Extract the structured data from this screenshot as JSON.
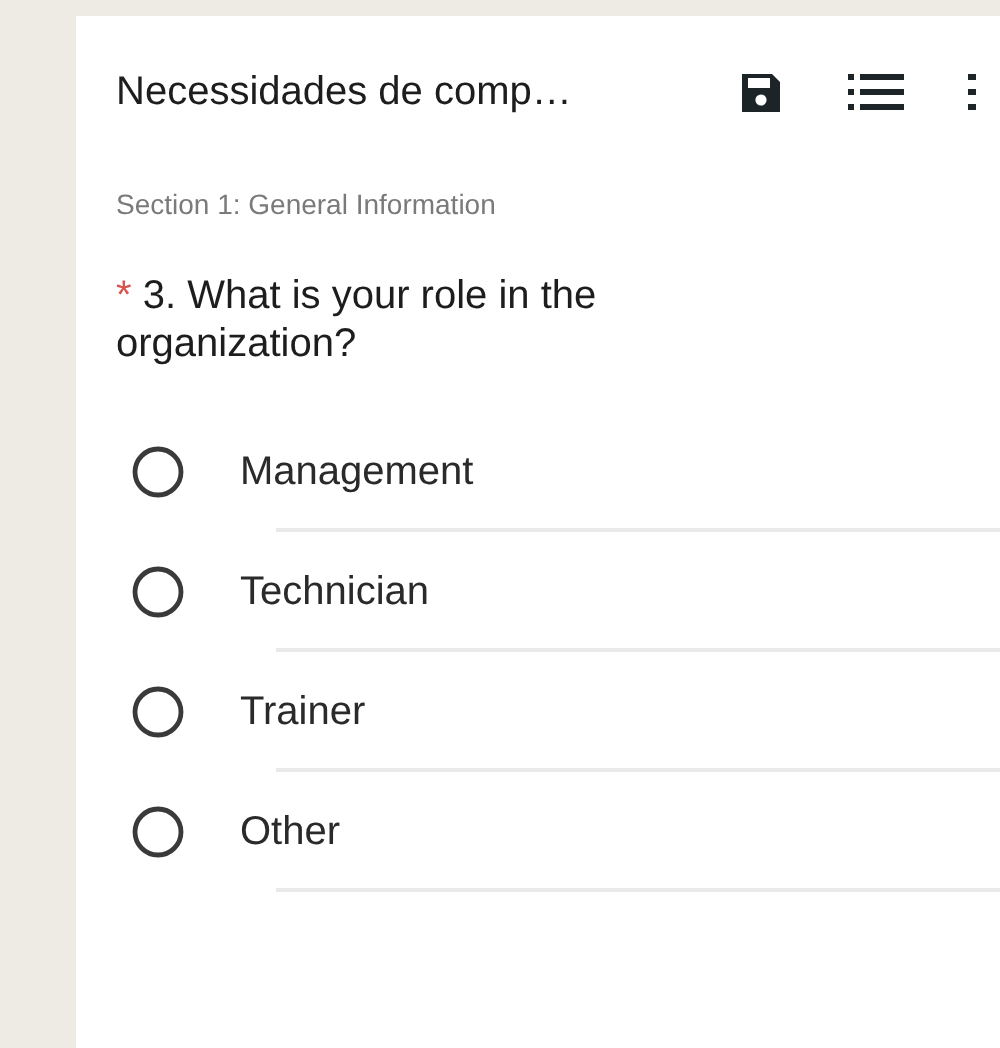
{
  "header": {
    "title": "Necessidades de comp…"
  },
  "section": {
    "label": "Section 1: General Information"
  },
  "question": {
    "required_mark": "*",
    "text": "3. What is your role in the organization?",
    "options": [
      {
        "label": "Management",
        "selected": false
      },
      {
        "label": "Technician",
        "selected": false
      },
      {
        "label": "Trainer",
        "selected": false
      },
      {
        "label": "Other",
        "selected": false
      }
    ]
  }
}
